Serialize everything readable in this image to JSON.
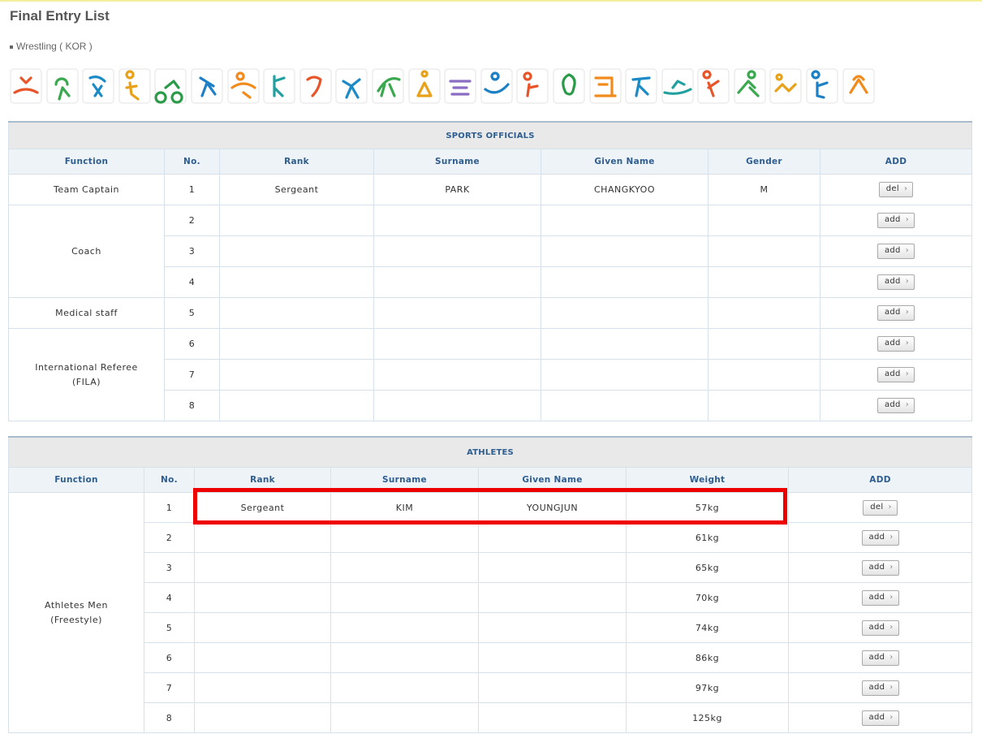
{
  "page": {
    "title": "Final Entry List",
    "subtitle": "Wrestling ( KOR )"
  },
  "pictograms": [
    {
      "icon": "sport-pictogram-1-icon",
      "color": "#e8552a"
    },
    {
      "icon": "sport-pictogram-2-icon",
      "color": "#3aa84f"
    },
    {
      "icon": "sport-pictogram-3-icon",
      "color": "#1c8ac4"
    },
    {
      "icon": "sport-pictogram-4-icon",
      "color": "#e8a21a"
    },
    {
      "icon": "sport-pictogram-5-icon",
      "color": "#2b9b4a"
    },
    {
      "icon": "sport-pictogram-6-icon",
      "color": "#1d7fc4"
    },
    {
      "icon": "sport-pictogram-7-icon",
      "color": "#f08b1c"
    },
    {
      "icon": "sport-pictogram-8-icon",
      "color": "#22a0a0"
    },
    {
      "icon": "sport-pictogram-9-icon",
      "color": "#e8552a"
    },
    {
      "icon": "sport-pictogram-10-icon",
      "color": "#1c8ac4"
    },
    {
      "icon": "sport-pictogram-11-icon",
      "color": "#3aa84f"
    },
    {
      "icon": "sport-pictogram-12-icon",
      "color": "#e8a21a"
    },
    {
      "icon": "sport-pictogram-13-icon",
      "color": "#8a6cc4"
    },
    {
      "icon": "sport-pictogram-14-icon",
      "color": "#1d7fc4"
    },
    {
      "icon": "sport-pictogram-15-icon",
      "color": "#e8552a"
    },
    {
      "icon": "sport-pictogram-16-icon",
      "color": "#2b9b4a"
    },
    {
      "icon": "sport-pictogram-17-icon",
      "color": "#f08b1c"
    },
    {
      "icon": "sport-pictogram-18-icon",
      "color": "#1c8ac4"
    },
    {
      "icon": "sport-pictogram-19-icon",
      "color": "#22a0a0"
    },
    {
      "icon": "sport-pictogram-20-icon",
      "color": "#e8552a"
    },
    {
      "icon": "sport-pictogram-21-icon",
      "color": "#3aa84f"
    },
    {
      "icon": "sport-pictogram-22-icon",
      "color": "#e8a21a"
    },
    {
      "icon": "sport-pictogram-23-icon",
      "color": "#1d7fc4"
    },
    {
      "icon": "sport-pictogram-24-icon",
      "color": "#f08b1c"
    }
  ],
  "officials": {
    "caption": "SPORTS OFFICIALS",
    "headers": {
      "function": "Function",
      "no": "No.",
      "rank": "Rank",
      "surname": "Surname",
      "given": "Given Name",
      "gender": "Gender",
      "add": "ADD"
    },
    "groups": {
      "captain": "Team Captain",
      "coach": "Coach",
      "medical": "Medical staff",
      "referee_line1": "International Referee",
      "referee_line2": "(FILA)"
    },
    "rows": [
      {
        "no": "1",
        "rank": "Sergeant",
        "surname": "PARK",
        "given": "CHANGKYOO",
        "gender": "M",
        "button": "del"
      },
      {
        "no": "2",
        "rank": "",
        "surname": "",
        "given": "",
        "gender": "",
        "button": "add"
      },
      {
        "no": "3",
        "rank": "",
        "surname": "",
        "given": "",
        "gender": "",
        "button": "add"
      },
      {
        "no": "4",
        "rank": "",
        "surname": "",
        "given": "",
        "gender": "",
        "button": "add"
      },
      {
        "no": "5",
        "rank": "",
        "surname": "",
        "given": "",
        "gender": "",
        "button": "add"
      },
      {
        "no": "6",
        "rank": "",
        "surname": "",
        "given": "",
        "gender": "",
        "button": "add"
      },
      {
        "no": "7",
        "rank": "",
        "surname": "",
        "given": "",
        "gender": "",
        "button": "add"
      },
      {
        "no": "8",
        "rank": "",
        "surname": "",
        "given": "",
        "gender": "",
        "button": "add"
      }
    ]
  },
  "athletes": {
    "caption": "ATHLETES",
    "headers": {
      "function": "Function",
      "no": "No.",
      "rank": "Rank",
      "surname": "Surname",
      "given": "Given Name",
      "weight": "Weight",
      "add": "ADD"
    },
    "group_line1": "Athletes Men",
    "group_line2": "(Freestyle)",
    "rows": [
      {
        "no": "1",
        "rank": "Sergeant",
        "surname": "KIM",
        "given": "YOUNGJUN",
        "weight": "57kg",
        "button": "del"
      },
      {
        "no": "2",
        "rank": "",
        "surname": "",
        "given": "",
        "weight": "61kg",
        "button": "add"
      },
      {
        "no": "3",
        "rank": "",
        "surname": "",
        "given": "",
        "weight": "65kg",
        "button": "add"
      },
      {
        "no": "4",
        "rank": "",
        "surname": "",
        "given": "",
        "weight": "70kg",
        "button": "add"
      },
      {
        "no": "5",
        "rank": "",
        "surname": "",
        "given": "",
        "weight": "74kg",
        "button": "add"
      },
      {
        "no": "6",
        "rank": "",
        "surname": "",
        "given": "",
        "weight": "86kg",
        "button": "add"
      },
      {
        "no": "7",
        "rank": "",
        "surname": "",
        "given": "",
        "weight": "97kg",
        "button": "add"
      },
      {
        "no": "8",
        "rank": "",
        "surname": "",
        "given": "",
        "weight": "125kg",
        "button": "add"
      }
    ]
  },
  "highlight_color": "#ee0000",
  "chevron": "›"
}
